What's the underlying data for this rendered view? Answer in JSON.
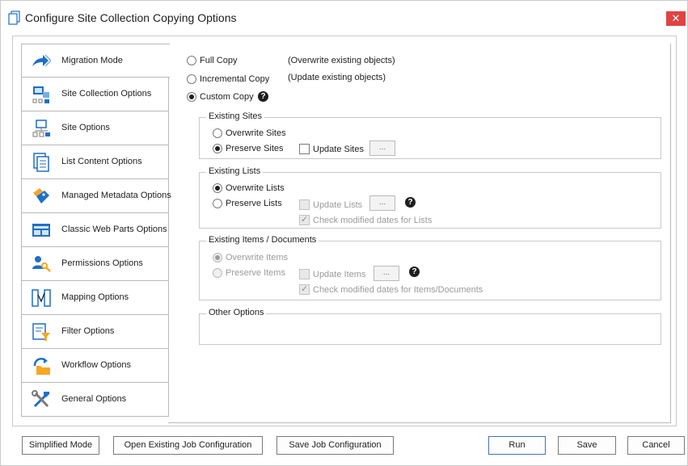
{
  "window": {
    "title": "Configure Site Collection Copying Options",
    "close_label": "✕"
  },
  "tabs": [
    {
      "label": "Migration Mode",
      "icon": "arrow-right-icon"
    },
    {
      "label": "Site Collection Options",
      "icon": "site-collection-icon"
    },
    {
      "label": "Site Options",
      "icon": "site-icon"
    },
    {
      "label": "List Content Options",
      "icon": "list-content-icon"
    },
    {
      "label": "Managed Metadata Options",
      "icon": "tag-icon"
    },
    {
      "label": "Classic Web Parts Options",
      "icon": "web-parts-icon"
    },
    {
      "label": "Permissions Options",
      "icon": "permissions-icon"
    },
    {
      "label": "Mapping Options",
      "icon": "mapping-icon"
    },
    {
      "label": "Filter Options",
      "icon": "filter-icon"
    },
    {
      "label": "Workflow Options",
      "icon": "workflow-icon"
    },
    {
      "label": "General Options",
      "icon": "tools-icon"
    }
  ],
  "mode": {
    "full_copy": "Full Copy",
    "full_copy_desc": "(Overwrite existing objects)",
    "incremental_copy": "Incremental Copy",
    "incremental_copy_desc": "(Update existing objects)",
    "custom_copy": "Custom Copy",
    "selected": "Custom Copy"
  },
  "existing_sites": {
    "title": "Existing Sites",
    "overwrite": "Overwrite Sites",
    "preserve": "Preserve Sites",
    "update": "Update Sites",
    "ellipsis": "..."
  },
  "existing_lists": {
    "title": "Existing Lists",
    "overwrite": "Overwrite Lists",
    "preserve": "Preserve Lists",
    "update": "Update Lists",
    "ellipsis": "...",
    "check_modified": "Check modified dates for Lists"
  },
  "existing_items": {
    "title": "Existing Items / Documents",
    "overwrite": "Overwrite Items",
    "preserve": "Preserve Items",
    "update": "Update Items",
    "ellipsis": "...",
    "check_modified": "Check modified dates for Items/Documents"
  },
  "other_options": {
    "title": "Other Options"
  },
  "help_glyph": "?",
  "footer": {
    "simplified_mode": "Simplified Mode",
    "open_existing": "Open Existing Job Configuration",
    "save_job": "Save Job Configuration",
    "run": "Run",
    "save": "Save",
    "cancel": "Cancel"
  },
  "colors": {
    "accent": "#1f6fc5",
    "close": "#e04343",
    "icon_orange": "#f5a623"
  }
}
